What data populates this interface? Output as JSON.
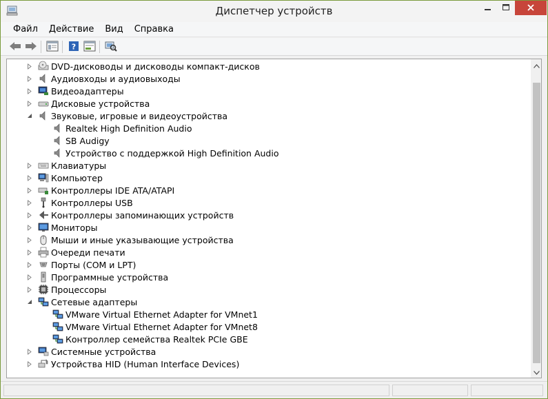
{
  "window": {
    "title": "Диспетчер устройств",
    "accent_color": "#7a9b3c",
    "close_color": "#c7453a"
  },
  "menu": {
    "file": "Файл",
    "action": "Действие",
    "view": "Вид",
    "help": "Справка"
  },
  "toolbar": {
    "buttons": [
      "back-icon",
      "forward-icon",
      "show-hide-console-tree-icon",
      "help-icon",
      "properties-icon",
      "scan-hardware-icon"
    ]
  },
  "tree": {
    "items": [
      {
        "label": "DVD-дисководы и дисководы компакт-дисков",
        "icon": "dvd-drive-icon",
        "level": 0,
        "state": "collapsed"
      },
      {
        "label": "Аудиовходы и аудиовыходы",
        "icon": "speaker-icon",
        "level": 0,
        "state": "collapsed"
      },
      {
        "label": "Видеоадаптеры",
        "icon": "display-adapter-icon",
        "level": 0,
        "state": "collapsed"
      },
      {
        "label": "Дисковые устройства",
        "icon": "disk-drive-icon",
        "level": 0,
        "state": "collapsed"
      },
      {
        "label": "Звуковые, игровые и видеоустройства",
        "icon": "speaker-icon",
        "level": 0,
        "state": "expanded"
      },
      {
        "label": "Realtek High Definition Audio",
        "icon": "speaker-icon",
        "level": 1,
        "state": "leaf"
      },
      {
        "label": "SB Audigy",
        "icon": "speaker-icon",
        "level": 1,
        "state": "leaf"
      },
      {
        "label": "Устройство с поддержкой High Definition Audio",
        "icon": "speaker-icon",
        "level": 1,
        "state": "leaf"
      },
      {
        "label": "Клавиатуры",
        "icon": "keyboard-icon",
        "level": 0,
        "state": "collapsed"
      },
      {
        "label": "Компьютер",
        "icon": "computer-icon",
        "level": 0,
        "state": "collapsed"
      },
      {
        "label": "Контроллеры IDE ATA/ATAPI",
        "icon": "ide-controller-icon",
        "level": 0,
        "state": "collapsed"
      },
      {
        "label": "Контроллеры USB",
        "icon": "usb-icon",
        "level": 0,
        "state": "collapsed"
      },
      {
        "label": "Контроллеры запоминающих устройств",
        "icon": "storage-controller-icon",
        "level": 0,
        "state": "collapsed"
      },
      {
        "label": "Мониторы",
        "icon": "monitor-icon",
        "level": 0,
        "state": "collapsed"
      },
      {
        "label": "Мыши и иные указывающие устройства",
        "icon": "mouse-icon",
        "level": 0,
        "state": "collapsed"
      },
      {
        "label": "Очереди печати",
        "icon": "printer-icon",
        "level": 0,
        "state": "collapsed"
      },
      {
        "label": "Порты (COM и LPT)",
        "icon": "port-icon",
        "level": 0,
        "state": "collapsed"
      },
      {
        "label": "Программные устройства",
        "icon": "software-device-icon",
        "level": 0,
        "state": "collapsed"
      },
      {
        "label": "Процессоры",
        "icon": "processor-icon",
        "level": 0,
        "state": "collapsed"
      },
      {
        "label": "Сетевые адаптеры",
        "icon": "network-adapter-icon",
        "level": 0,
        "state": "expanded"
      },
      {
        "label": "VMware Virtual Ethernet Adapter for VMnet1",
        "icon": "network-adapter-icon",
        "level": 1,
        "state": "leaf"
      },
      {
        "label": "VMware Virtual Ethernet Adapter for VMnet8",
        "icon": "network-adapter-icon",
        "level": 1,
        "state": "leaf"
      },
      {
        "label": "Контроллер семейства Realtek PCIe GBE",
        "icon": "network-adapter-icon",
        "level": 1,
        "state": "leaf"
      },
      {
        "label": "Системные устройства",
        "icon": "system-device-icon",
        "level": 0,
        "state": "collapsed"
      },
      {
        "label": "Устройства HID (Human Interface Devices)",
        "icon": "hid-icon",
        "level": 0,
        "state": "collapsed"
      }
    ]
  }
}
